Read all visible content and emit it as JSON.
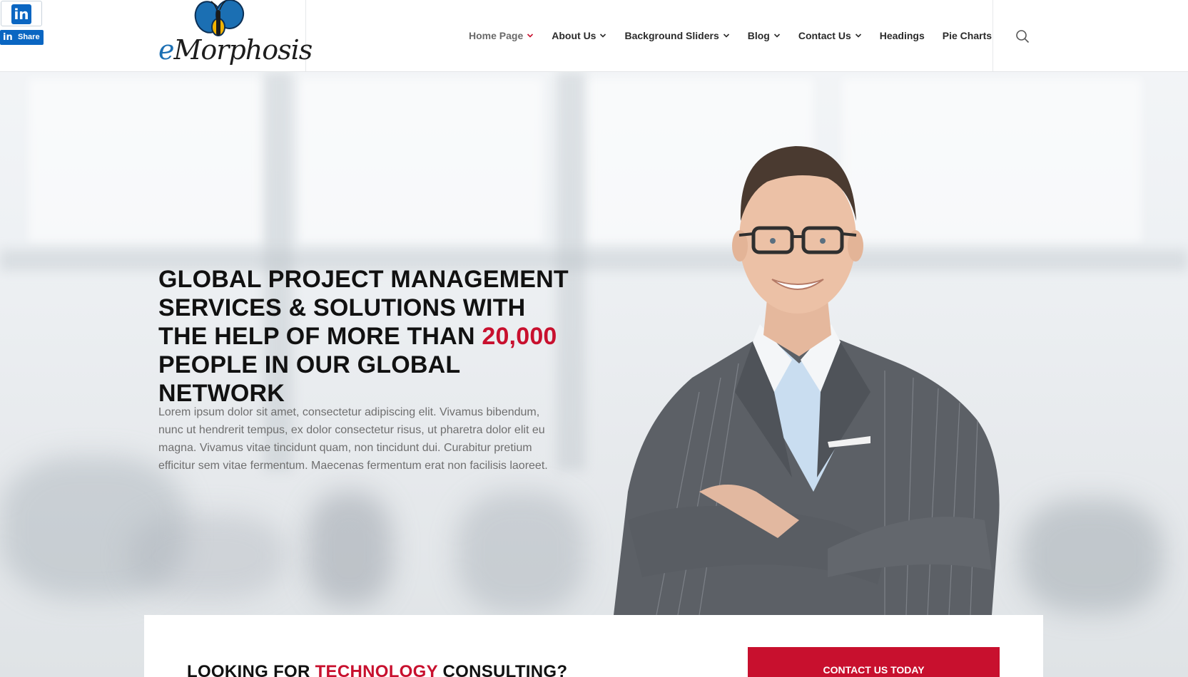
{
  "brand": {
    "logo_text_prefix": "e",
    "logo_text_main": "Morphosis",
    "logo_icon": "butterfly-icon"
  },
  "linkedin": {
    "icon_text": "in",
    "share_label": "Share",
    "share_icon_text": "in"
  },
  "nav": {
    "items": [
      {
        "label": "Home Page",
        "has_dropdown": true
      },
      {
        "label": "About Us",
        "has_dropdown": true
      },
      {
        "label": "Background Sliders",
        "has_dropdown": true
      },
      {
        "label": "Blog",
        "has_dropdown": true
      },
      {
        "label": "Contact Us",
        "has_dropdown": true
      },
      {
        "label": "Headings",
        "has_dropdown": false
      },
      {
        "label": "Pie Charts",
        "has_dropdown": false
      }
    ],
    "search_icon": "search-icon"
  },
  "hero": {
    "title_before": "Global project management services & solutions with the help of more than ",
    "title_accent": "20,000",
    "title_after": " people in our global network",
    "text": "Lorem ipsum dolor sit amet, consectetur adipiscing elit. Vivamus bibendum, nunc ut hendrerit tempus, ex dolor consectetur risus, ut pharetra dolor elit eu magna. Vivamus vitae tincidunt quam, non tincidunt dui. Curabitur pretium efficitur sem vitae fermentum. Maecenas fermentum erat non facilisis laoreet."
  },
  "card": {
    "heading_before": "Looking for ",
    "heading_accent": "technology",
    "heading_after": " consulting?",
    "cta_label": "Contact us today"
  },
  "colors": {
    "accent": "#c8102e",
    "linkedin": "#0a66c2",
    "text_dark": "#111111",
    "text_muted": "#6f6f6f"
  }
}
